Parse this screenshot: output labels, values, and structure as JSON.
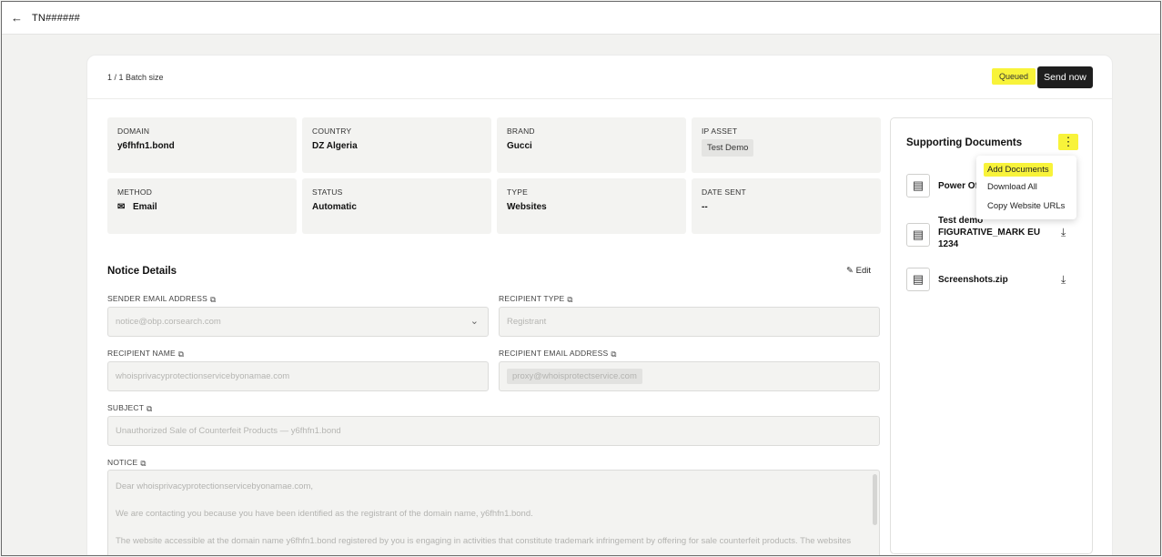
{
  "topbar": {
    "back_icon": "arrow-left-icon",
    "title": "TN######"
  },
  "header": {
    "batch": "1 / 1 Batch size",
    "status_badge": "Queued",
    "send_now": "Send now"
  },
  "info": {
    "domain": {
      "label": "DOMAIN",
      "value": "y6fhfn1.bond"
    },
    "country": {
      "label": "COUNTRY",
      "value": "DZ Algeria"
    },
    "brand": {
      "label": "BRAND",
      "value": "Gucci"
    },
    "ip_asset": {
      "label": "IP ASSET",
      "value": "Test Demo"
    },
    "method": {
      "label": "METHOD",
      "value": "Email",
      "icon": "envelope-icon"
    },
    "status": {
      "label": "STATUS",
      "value": "Automatic"
    },
    "type": {
      "label": "TYPE",
      "value": "Websites"
    },
    "date_sent": {
      "label": "DATE SENT",
      "value": "--"
    }
  },
  "notice": {
    "title": "Notice Details",
    "edit": "Edit",
    "sender_email": {
      "label": "SENDER EMAIL ADDRESS",
      "value": "notice@obp.corsearch.com"
    },
    "recipient_type": {
      "label": "RECIPIENT TYPE",
      "value": "Registrant"
    },
    "recipient_name": {
      "label": "RECIPIENT NAME",
      "value": "whoisprivacyprotectionservicebyonamae.com"
    },
    "recipient_email": {
      "label": "RECIPIENT EMAIL ADDRESS",
      "value": "proxy@whoisprotectservice.com"
    },
    "subject": {
      "label": "SUBJECT",
      "value": "Unauthorized Sale of Counterfeit Products — y6fhfn1.bond"
    },
    "notice_body": {
      "label": "NOTICE",
      "line1": "Dear whoisprivacyprotectionservicebyonamae.com,",
      "line2": "We are contacting you because you have been identified as the registrant of the domain name, y6fhfn1.bond.",
      "line3": "The website accessible at the domain name y6fhfn1.bond registered by you is engaging in activities that constitute trademark infringement by offering for sale counterfeit products. The websites"
    }
  },
  "sidebar": {
    "title": "Supporting Documents",
    "documents": [
      {
        "name": "Power Of"
      },
      {
        "name": "Test demo FIGURATIVE_MARK EU 1234"
      },
      {
        "name": "Screenshots.zip"
      }
    ],
    "menu": {
      "add": "Add Documents",
      "download_all": "Download All",
      "copy_urls": "Copy Website URLs"
    }
  },
  "colors": {
    "highlight": "#f8f33a",
    "primary_button": "#1e1e1e"
  }
}
